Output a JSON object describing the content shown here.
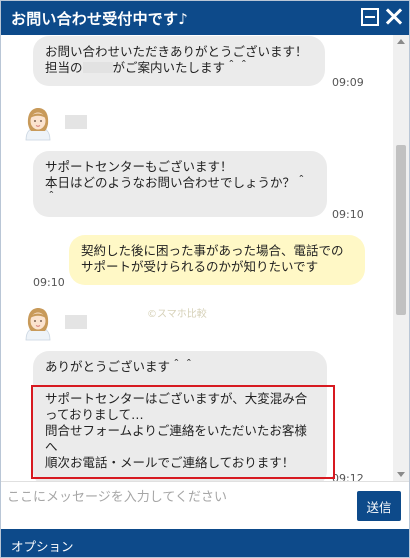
{
  "header": {
    "title": "お問い合わせ受付中です♪"
  },
  "messages": [
    {
      "sender": "operator",
      "lines": [
        "お問い合わせいただきありがとうございます！",
        "担当の",
        "がご案内いたします＾＾"
      ],
      "time": "09:09"
    },
    {
      "sender": "operator",
      "lines": [
        "サポートセンターもございます！",
        "本日はどのようなお問い合わせでしょうか？＾",
        "＾"
      ],
      "time": "09:10"
    },
    {
      "sender": "user",
      "lines": [
        "契約した後に困った事があった場合、電話での",
        "サポートが受けられるのかが知りたいです"
      ],
      "time": "09:10"
    },
    {
      "sender": "operator",
      "lines": [
        "ありがとうございます＾＾",
        "サポートセンターはございますが、大変混み合",
        "っておりまして…",
        "問合せフォームよりご連絡をいただいたお客様",
        "へ",
        "順次お電話・メールでご連絡しております！"
      ],
      "time": "09:12"
    }
  ],
  "watermark": "©スマホ比較",
  "input": {
    "placeholder": "ここにメッセージを入力してください",
    "value": ""
  },
  "send_label": "送信",
  "footer": {
    "options_label": "オプション"
  },
  "colors": {
    "header": "#0d4a8a",
    "operator_bubble": "#ebebeb",
    "user_bubble": "#fff8c6",
    "highlight": "#d71920"
  }
}
